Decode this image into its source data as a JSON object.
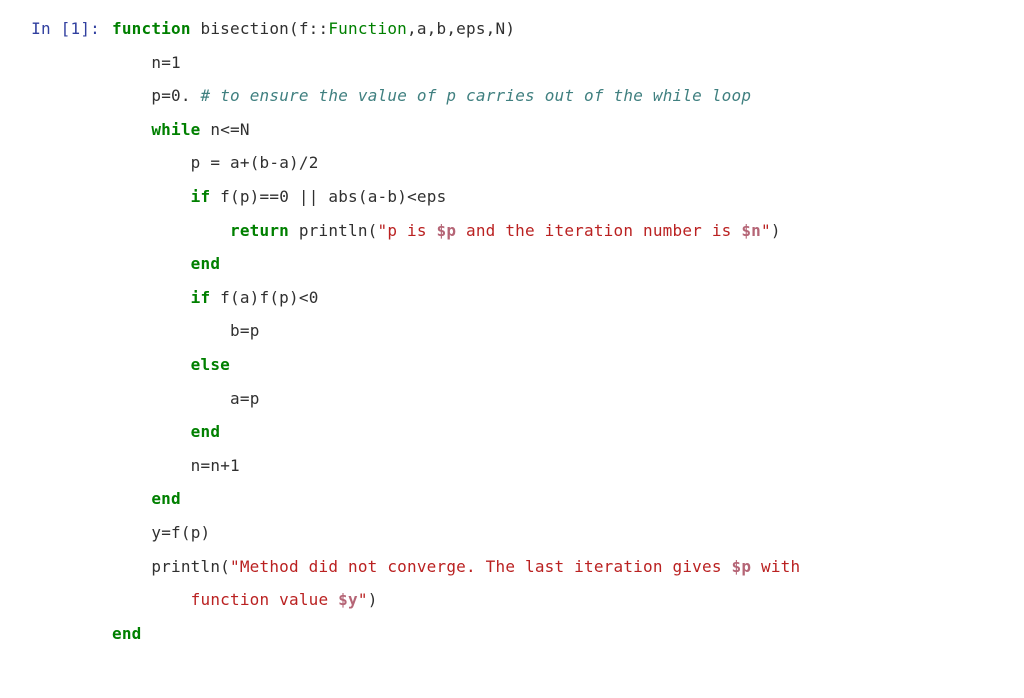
{
  "prompt": "In [1]:",
  "code": {
    "l1": {
      "a": "function",
      "b": " bisection(f",
      "c": "::",
      "d": "Function",
      "e": ",a,b,eps,N)"
    },
    "l2": {
      "a": "n",
      "b": "=",
      "c": "1"
    },
    "l3": {
      "a": "p",
      "b": "=",
      "c": "0.",
      "d": " ",
      "e": "# to ensure the value of p carries out of the while loop"
    },
    "l4": {
      "a": "while",
      "b": " n",
      "c": "<=",
      "d": "N"
    },
    "l5": {
      "a": "p ",
      "b": "=",
      "c": " a",
      "d": "+",
      "e": "(b",
      "f": "-",
      "g": "a)",
      "h": "/",
      "i": "2"
    },
    "l6": {
      "a": "if",
      "b": " f(p)",
      "c": "==",
      "d": "0",
      "e": " ",
      "f": "||",
      "g": " abs(a",
      "h": "-",
      "i": "b)",
      "j": "<",
      "k": "eps"
    },
    "l7": {
      "a": "return",
      "b": " println(",
      "c": "\"p is ",
      "d": "$p",
      "e": " and the iteration number is ",
      "f": "$n",
      "g": "\"",
      "h": ")"
    },
    "l8": {
      "a": "end"
    },
    "l9": {
      "a": "if",
      "b": " f(a)f(p)",
      "c": "<",
      "d": "0"
    },
    "l10": {
      "a": "b",
      "b": "=",
      "c": "p"
    },
    "l11": {
      "a": "else"
    },
    "l12": {
      "a": "a",
      "b": "=",
      "c": "p"
    },
    "l13": {
      "a": "end"
    },
    "l14": {
      "a": "n",
      "b": "=",
      "c": "n",
      "d": "+",
      "e": "1"
    },
    "l15": {
      "a": "end"
    },
    "l16": {
      "a": "y",
      "b": "=",
      "c": "f(p)"
    },
    "l17": {
      "a": "println(",
      "b": "\"Method did not converge. The last iteration gives ",
      "c": "$p",
      "d": " with"
    },
    "l18": {
      "a": "function value ",
      "b": "$y",
      "c": "\"",
      "d": ")"
    },
    "l19": {
      "a": "end"
    }
  }
}
